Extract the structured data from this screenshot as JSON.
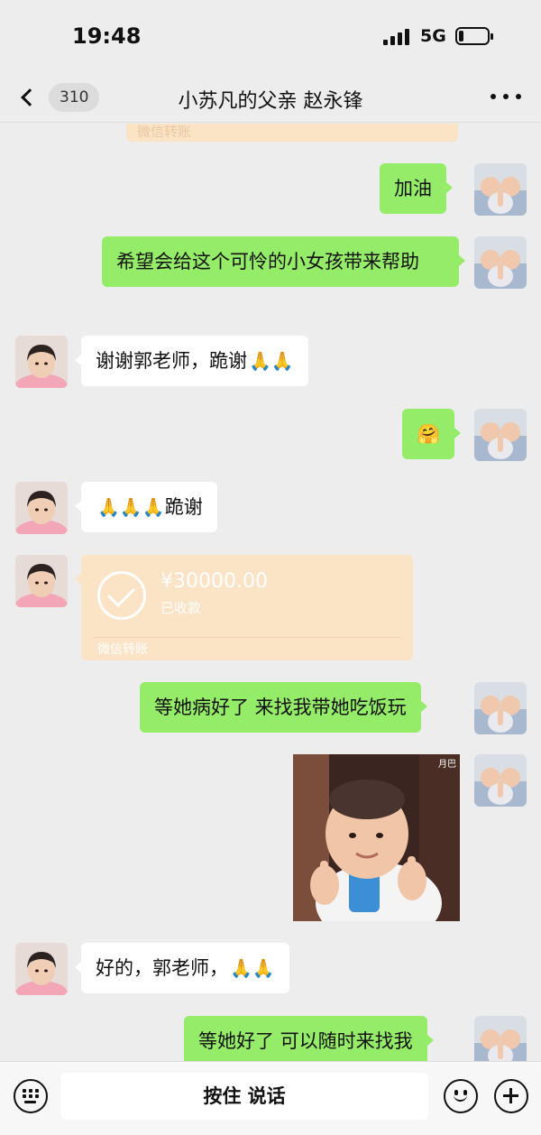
{
  "status_bar": {
    "time": "19:48",
    "network": "5G",
    "battery_level": 0.15
  },
  "nav": {
    "back_count": "310",
    "title": "小苏凡的父亲 赵永锋"
  },
  "colors": {
    "bg": "#ededed",
    "my_bubble": "#95ec69",
    "other_bubble": "#ffffff",
    "transfer_card": "#fbe3c6"
  },
  "partial_transfer": {
    "label": "微信转账"
  },
  "messages": [
    {
      "sender": "me",
      "text": "加油"
    },
    {
      "sender": "me",
      "text": "希望会给这个可怜的小女孩带来帮助"
    },
    {
      "sender": "other",
      "text": "谢谢郭老师，跪谢",
      "emoji": "🙏🙏"
    },
    {
      "sender": "me",
      "emoji": "🤗"
    },
    {
      "sender": "other",
      "emoji": "🙏🙏🙏",
      "text": "跪谢"
    },
    {
      "sender": "other",
      "type": "transfer",
      "amount": "¥30000.00",
      "status": "已收款",
      "label": "微信转账"
    },
    {
      "sender": "me",
      "text": "等她病好了 来找我带她吃饭玩"
    },
    {
      "sender": "me",
      "type": "gif",
      "tag": "月巴",
      "icon": "baby-thumbs-up-sticker"
    },
    {
      "sender": "other",
      "text": "好的，郭老师，",
      "emoji": "🙏🙏"
    },
    {
      "sender": "me",
      "text": "等她好了 可以随时来找我"
    }
  ],
  "input_bar": {
    "talk_label": "按住 说话"
  }
}
